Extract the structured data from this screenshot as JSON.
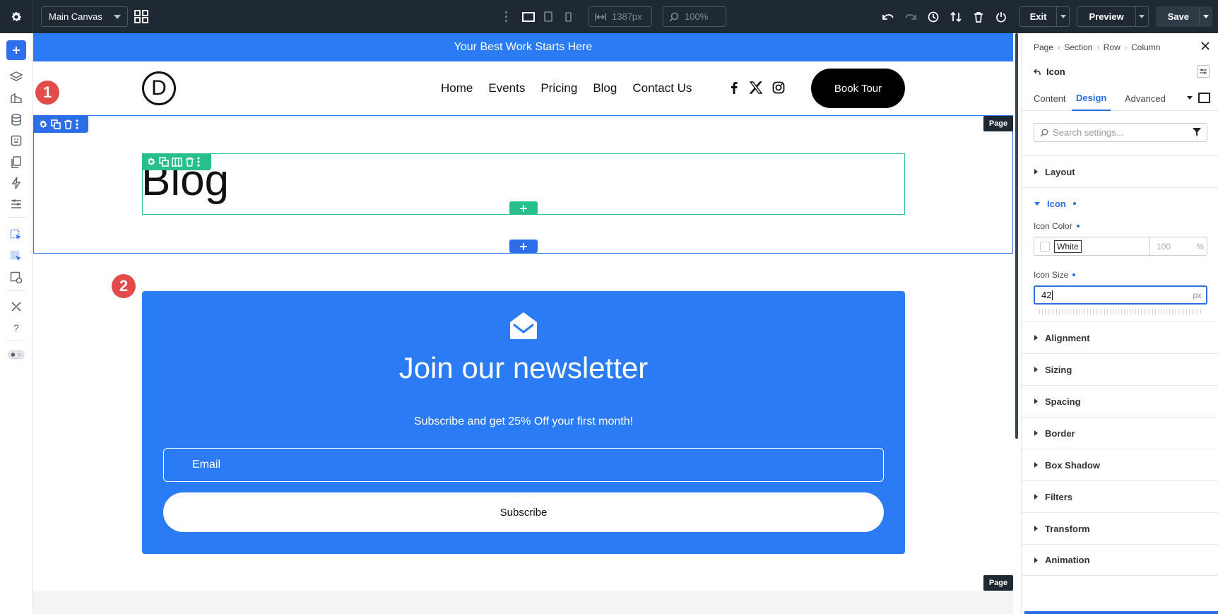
{
  "topbar": {
    "canvas_select": "Main Canvas",
    "width_value": "1387px",
    "zoom_value": "100%",
    "exit_label": "Exit",
    "preview_label": "Preview",
    "save_label": "Save"
  },
  "canvas": {
    "banner_text": "Your Best Work Starts Here",
    "logo_letter": "D",
    "nav": [
      "Home",
      "Events",
      "Pricing",
      "Blog",
      "Contact Us"
    ],
    "book_button": "Book Tour",
    "page_tag": "Page",
    "badges": [
      "1",
      "2"
    ],
    "blog_title": "Blog",
    "newsletter": {
      "title": "Join our newsletter",
      "subtitle": "Subscribe and get 25% Off your first month!",
      "email_placeholder": "Email",
      "button": "Subscribe"
    }
  },
  "panel": {
    "breadcrumb": [
      "Page",
      "Section",
      "Row",
      "Column"
    ],
    "module_title": "Icon",
    "tabs": [
      "Content",
      "Design",
      "Advanced"
    ],
    "active_tab": "Design",
    "search_placeholder": "Search settings...",
    "groups_before": [
      "Layout"
    ],
    "open_group": "Icon",
    "icon_color_label": "Icon Color",
    "icon_color_value": "White",
    "icon_color_opacity": "100",
    "opacity_unit": "%",
    "icon_size_label": "Icon Size",
    "icon_size_value": "42",
    "icon_size_unit": "px",
    "groups_after": [
      "Alignment",
      "Sizing",
      "Spacing",
      "Border",
      "Box Shadow",
      "Filters",
      "Transform",
      "Animation"
    ]
  },
  "colors": {
    "accent": "#2b6ee8",
    "banner": "#2b7cf4",
    "row_outline": "#27bf8b",
    "badge": "#e34b4b",
    "topbar": "#1f2933"
  }
}
